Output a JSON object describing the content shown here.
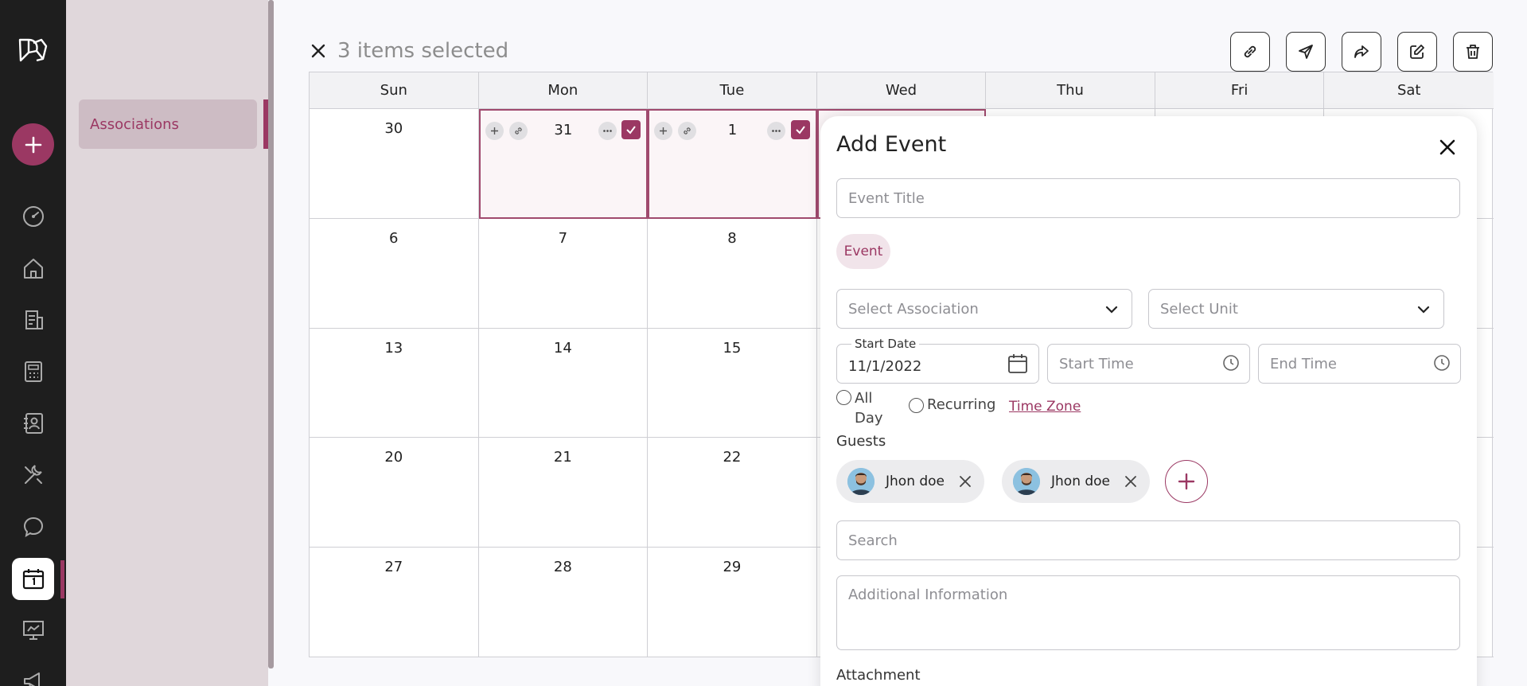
{
  "rail": {
    "icons": [
      "dashboard-icon",
      "home-icon",
      "ledger-icon",
      "calculator-icon",
      "contacts-icon",
      "tools-icon",
      "chat-icon",
      "calendar-icon",
      "presentation-icon",
      "megaphone-icon"
    ],
    "accent": "#9b3863"
  },
  "sidebar": {
    "items": [
      {
        "label": "Associations"
      }
    ]
  },
  "selection": {
    "text": "3 items selected"
  },
  "toolbar": {
    "buttons": [
      "link-icon",
      "send-icon",
      "share-icon",
      "edit-icon",
      "trash-icon"
    ]
  },
  "calendar": {
    "weekdays": [
      "Sun",
      "Mon",
      "Tue",
      "Wed",
      "Thu",
      "Fri",
      "Sat"
    ],
    "weeks": [
      [
        "30",
        "31",
        "1",
        "",
        "",
        "",
        ""
      ],
      [
        "6",
        "7",
        "8",
        "",
        "",
        "",
        ""
      ],
      [
        "13",
        "14",
        "15",
        "",
        "",
        "",
        ""
      ],
      [
        "20",
        "21",
        "22",
        "",
        "",
        "",
        ""
      ],
      [
        "27",
        "28",
        "29",
        "",
        "",
        "",
        ""
      ]
    ],
    "selected_days": [
      "31",
      "1"
    ]
  },
  "add_event": {
    "title": "Add Event",
    "event_title_placeholder": "Event Title",
    "type_chip": "Event",
    "association_placeholder": "Select Association",
    "unit_placeholder": "Select Unit",
    "start_date_label": "Start Date",
    "start_date_value": "11/1/2022",
    "start_time_placeholder": "Start Time",
    "end_time_placeholder": "End Time",
    "all_day_label": "All Day",
    "recurring_label": "Recurring",
    "time_zone_link": "Time Zone",
    "guests_label": "Guests",
    "guests": [
      {
        "name": "Jhon doe"
      },
      {
        "name": "Jhon doe"
      }
    ],
    "search_placeholder": "Search",
    "additional_info_placeholder": "Additional Information",
    "attachment_label": "Attachment"
  }
}
